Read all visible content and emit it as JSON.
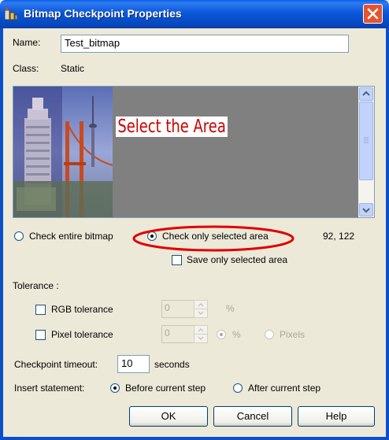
{
  "window": {
    "title": "Bitmap Checkpoint Properties"
  },
  "name_row": {
    "label": "Name:",
    "value": "Test_bitmap"
  },
  "class_row": {
    "label": "Class:",
    "value": "Static"
  },
  "preview": {
    "annotation": "Select the Area"
  },
  "check_mode": {
    "entire_label": "Check entire bitmap",
    "selected_label": "Check only selected area",
    "selected": "selected",
    "coordinates": "92, 122",
    "save_only_label": "Save only selected area"
  },
  "tolerance": {
    "heading": "Tolerance :",
    "rgb_label": "RGB tolerance",
    "rgb_value": "0",
    "rgb_unit": "%",
    "pixel_label": "Pixel tolerance",
    "pixel_value": "0",
    "percent_label": "%",
    "pixels_label": "Pixels"
  },
  "timeout": {
    "label": "Checkpoint timeout:",
    "value": "10",
    "unit": "seconds"
  },
  "insert": {
    "label": "Insert statement:",
    "before": "Before current step",
    "after": "After current step",
    "selected": "before"
  },
  "buttons": {
    "ok": "OK",
    "cancel": "Cancel",
    "help": "Help"
  },
  "colors": {
    "annotation_red": "#CC0000",
    "titlebar_blue": "#0A58D8",
    "close_red": "#E4552F"
  }
}
